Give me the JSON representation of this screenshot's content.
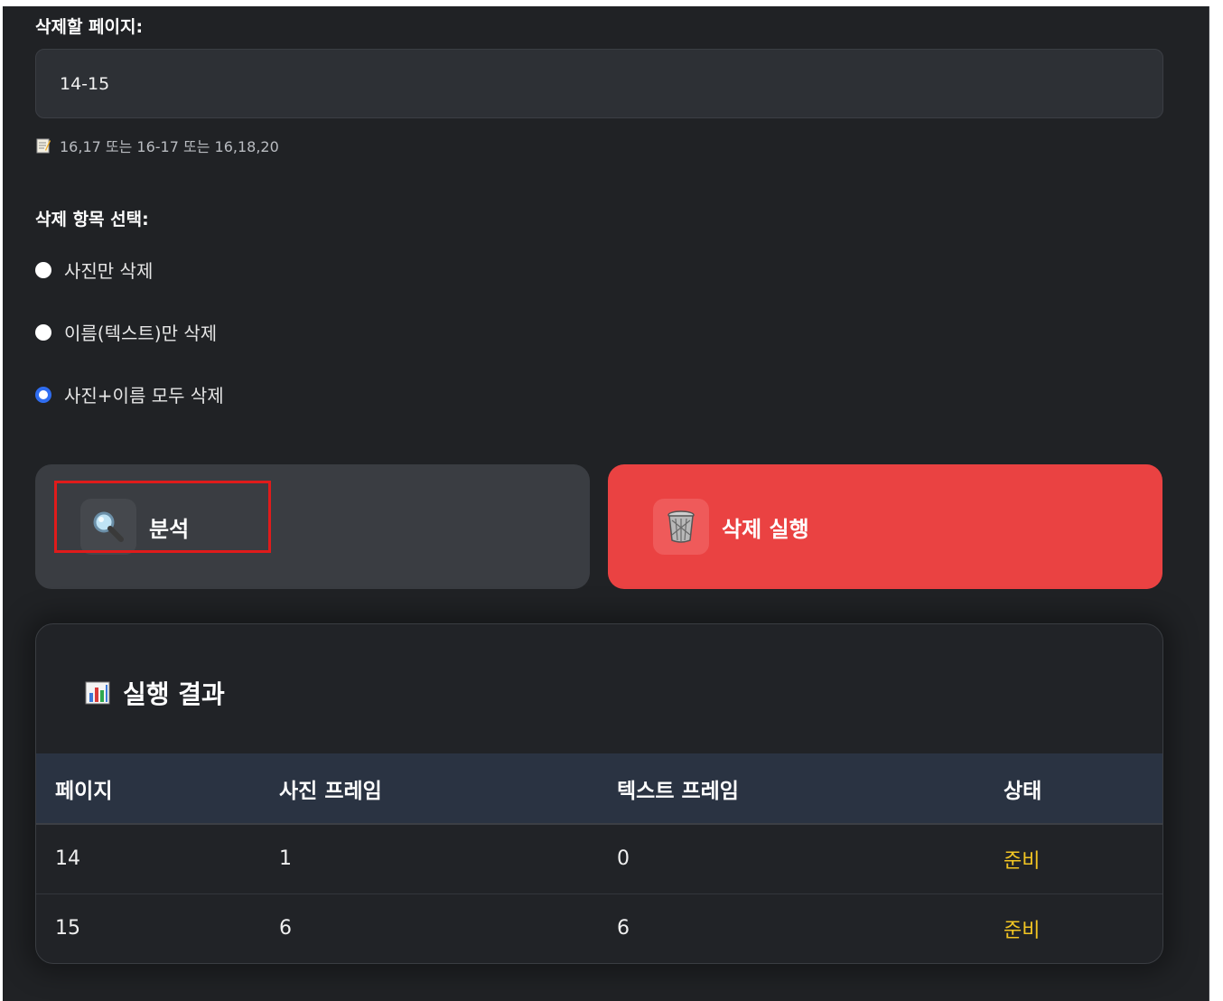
{
  "form": {
    "pages_label": "삭제할 페이지:",
    "pages_value": "14-15",
    "pages_hint": "16,17 또는 16-17 또는 16,18,20",
    "delete_items_label": "삭제 항목 선택:",
    "options": [
      {
        "label": "사진만 삭제",
        "checked": false
      },
      {
        "label": "이름(텍스트)만 삭제",
        "checked": false
      },
      {
        "label": "사진+이름 모두 삭제",
        "checked": true
      }
    ]
  },
  "actions": {
    "analyze_label": "분석",
    "analyze_icon": "magnifier-icon",
    "delete_label": "삭제 실행",
    "delete_icon": "trash-icon"
  },
  "results": {
    "title": "실행 결과",
    "title_icon": "bar-chart-icon",
    "columns": [
      "페이지",
      "사진 프레임",
      "텍스트 프레임",
      "상태"
    ],
    "rows": [
      {
        "page": "14",
        "photo_frames": "1",
        "text_frames": "0",
        "status": "준비"
      },
      {
        "page": "15",
        "photo_frames": "6",
        "text_frames": "6",
        "status": "준비"
      }
    ]
  },
  "colors": {
    "background": "#202225",
    "delete_button": "#ea4242",
    "status_ready": "#f3c623",
    "radio_selected": "#2f6df0",
    "highlight": "#e01b1b"
  }
}
